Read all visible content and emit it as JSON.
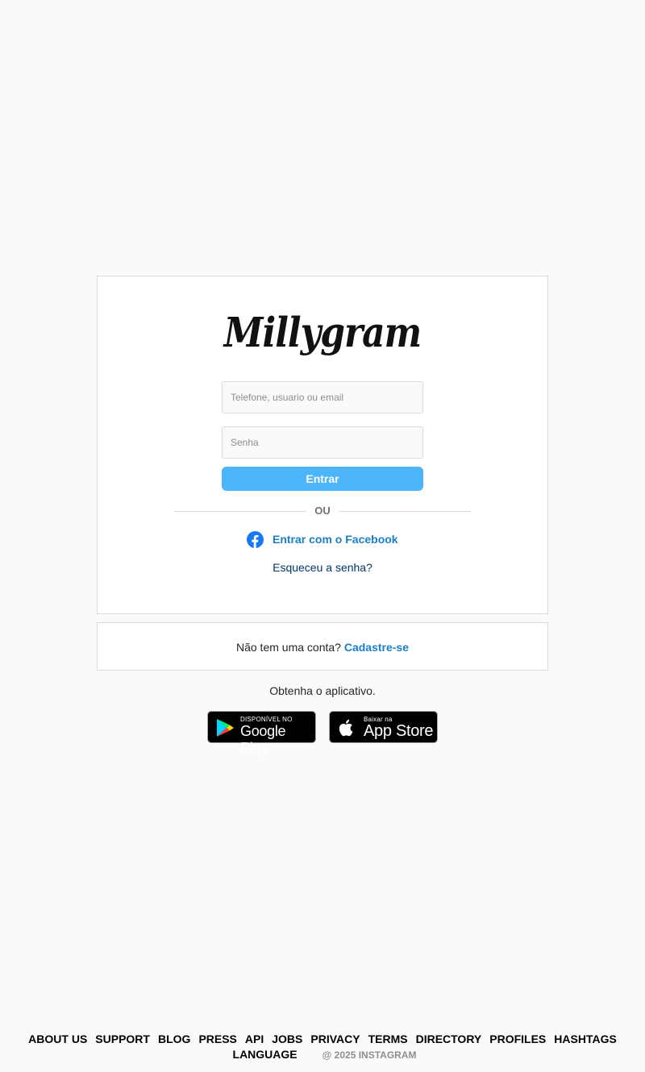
{
  "brand": {
    "logo_text": "Millygram"
  },
  "login": {
    "username_placeholder": "Telefone, usuario ou email",
    "password_placeholder": "Senha",
    "submit_label": "Entrar",
    "divider_text": "OU",
    "facebook_label": "Entrar com o Facebook",
    "forgot_label": "Esqueceu a senha?"
  },
  "signup": {
    "question": "Não tem uma conta?",
    "link_label": "Cadastre-se"
  },
  "app": {
    "prompt": "Obtenha o aplicativo.",
    "google_small": "DISPONÍVEL NO",
    "google_big": "Google Play",
    "apple_small": "Baixar na",
    "apple_big": "App Store"
  },
  "footer": {
    "links": [
      "ABOUT US",
      "SUPPORT",
      "BLOG",
      "PRESS",
      "API",
      "JOBS",
      "PRIVACY",
      "TERMS",
      "DIRECTORY",
      "PROFILES",
      "HASHTAGS",
      "LANGUAGE"
    ],
    "copyright": "@ 2025 INSTAGRAM"
  },
  "colors": {
    "primary_button": "#4cb5f9",
    "link": "#1a7fc7",
    "background": "#fafafa",
    "border": "#dbdbdb"
  }
}
